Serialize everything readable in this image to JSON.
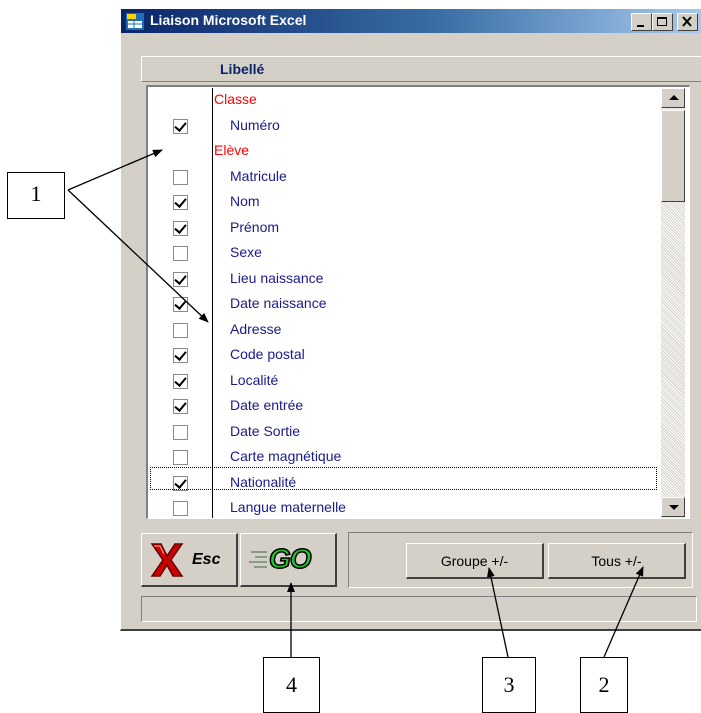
{
  "window": {
    "title": "Liaison Microsoft Excel",
    "controls": [
      "minimize",
      "maximize",
      "close"
    ]
  },
  "list": {
    "header": "Libellé",
    "rows": [
      {
        "type": "group",
        "label": "Classe"
      },
      {
        "type": "item",
        "label": "Numéro",
        "checked": true
      },
      {
        "type": "group",
        "label": "Elève"
      },
      {
        "type": "item",
        "label": "Matricule",
        "checked": false
      },
      {
        "type": "item",
        "label": "Nom",
        "checked": true
      },
      {
        "type": "item",
        "label": "Prénom",
        "checked": true
      },
      {
        "type": "item",
        "label": "Sexe",
        "checked": false
      },
      {
        "type": "item",
        "label": "Lieu naissance",
        "checked": true
      },
      {
        "type": "item",
        "label": "Date naissance",
        "checked": true
      },
      {
        "type": "item",
        "label": "Adresse",
        "checked": false
      },
      {
        "type": "item",
        "label": "Code postal",
        "checked": true
      },
      {
        "type": "item",
        "label": "Localité",
        "checked": true
      },
      {
        "type": "item",
        "label": "Date entrée",
        "checked": true
      },
      {
        "type": "item",
        "label": "Date Sortie",
        "checked": false
      },
      {
        "type": "item",
        "label": "Carte magnétique",
        "checked": false
      },
      {
        "type": "item",
        "label": "Nationalité",
        "checked": true,
        "focused": true
      },
      {
        "type": "item",
        "label": "Langue maternelle",
        "checked": false
      }
    ]
  },
  "toolbar": {
    "esc_label": "Esc",
    "go_label": "GO",
    "groupe_label": "Groupe +/-",
    "tous_label": "Tous +/-"
  },
  "callouts": {
    "c1": "1",
    "c2": "2",
    "c3": "3",
    "c4": "4"
  },
  "colors": {
    "title_bar": "#0a246a",
    "group_text": "#ff0000",
    "item_text": "#1a1a8c",
    "face": "#d4d0c8"
  }
}
